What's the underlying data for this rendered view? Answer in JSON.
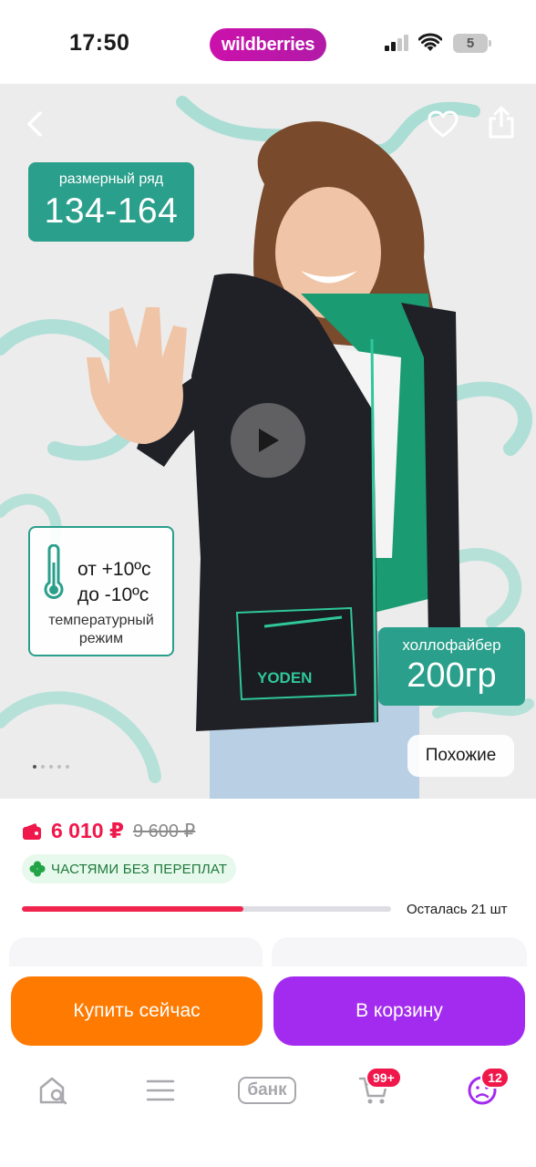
{
  "status_bar": {
    "time": "17:50",
    "logo": "wildberries",
    "battery": "5"
  },
  "hero": {
    "nav": {
      "back_icon": "chevron-left-icon",
      "favorite_icon": "heart-icon",
      "share_icon": "share-icon"
    },
    "size_badge": {
      "label": "размерный ряд",
      "value": "134-164"
    },
    "temperature_badge": {
      "line1": "от +10ºc",
      "line2": "до -10ºc",
      "caption": "температурный режим",
      "icon": "thermometer-icon"
    },
    "fiber_badge": {
      "label": "холлофайбер",
      "value": "200гр"
    },
    "print_text": "YODEN",
    "play_icon": "play-icon",
    "similar_label": "Похожие",
    "gallery": {
      "total": 5,
      "active": 1
    }
  },
  "product": {
    "price": "6 010 ₽",
    "old_price": "9 600 ₽",
    "installments_label": "ЧАСТЯМИ БЕЗ ПЕРЕПЛАТ",
    "stock": {
      "text": "Осталась 21 шт",
      "fill_fraction": 0.6
    }
  },
  "actions": {
    "buy_now": "Купить сейчас",
    "add_to_cart": "В корзину"
  },
  "tabbar": {
    "items": [
      {
        "name": "home",
        "icon": "home-search-icon"
      },
      {
        "name": "catalog",
        "icon": "menu-icon"
      },
      {
        "name": "bank",
        "label": "банк"
      },
      {
        "name": "cart",
        "icon": "cart-icon",
        "badge": "99+"
      },
      {
        "name": "profile",
        "icon": "profile-icon",
        "badge": "12"
      }
    ]
  },
  "colors": {
    "brand": "#cb11ab",
    "teal": "#2a9f8b",
    "price": "#f0174b",
    "buy": "#ff7a00",
    "cart": "#a32bef"
  }
}
